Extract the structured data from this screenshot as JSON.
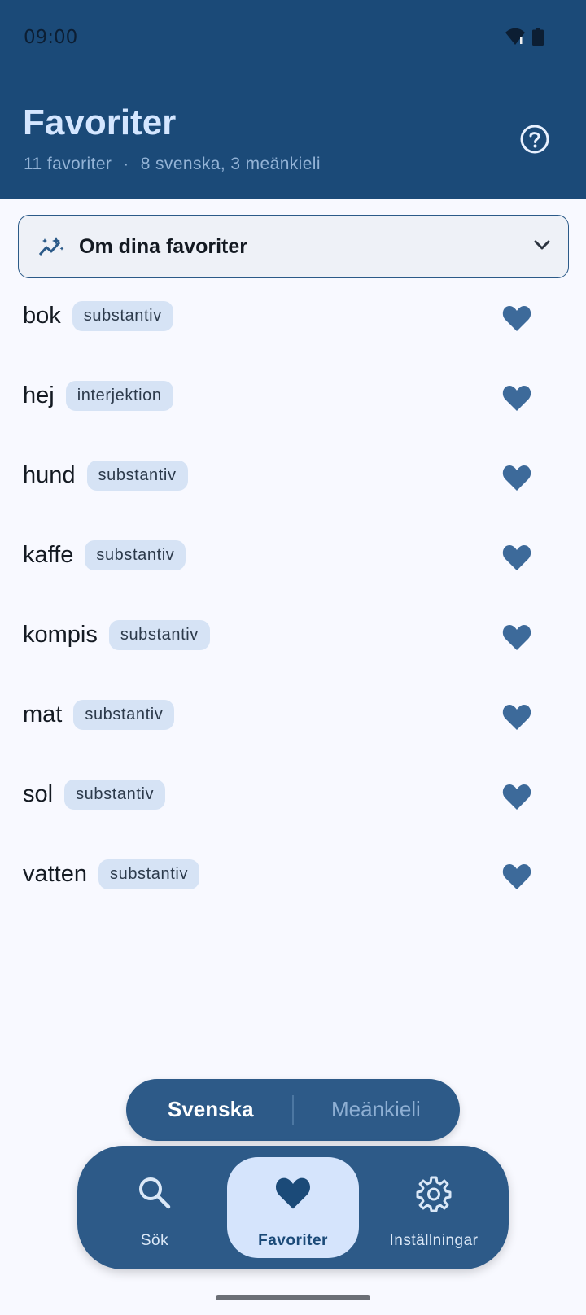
{
  "status_bar": {
    "time": "09:00"
  },
  "header": {
    "title": "Favoriter",
    "count": "11 favoriter",
    "separator": "·",
    "breakdown": "8 svenska, 3 meänkieli"
  },
  "about_card": {
    "label": "Om dina favoriter"
  },
  "favorites": [
    {
      "word": "bok",
      "pos": "substantiv"
    },
    {
      "word": "hej",
      "pos": "interjektion"
    },
    {
      "word": "hund",
      "pos": "substantiv"
    },
    {
      "word": "kaffe",
      "pos": "substantiv"
    },
    {
      "word": "kompis",
      "pos": "substantiv"
    },
    {
      "word": "mat",
      "pos": "substantiv"
    },
    {
      "word": "sol",
      "pos": "substantiv"
    },
    {
      "word": "vatten",
      "pos": "substantiv"
    }
  ],
  "language_toggle": {
    "selected": "Svenska",
    "options": [
      "Svenska",
      "Meänkieli"
    ]
  },
  "bottom_nav": {
    "items": [
      {
        "label": "Sök",
        "icon": "search-icon"
      },
      {
        "label": "Favoriter",
        "icon": "heart-icon"
      },
      {
        "label": "Inställningar",
        "icon": "gear-icon"
      }
    ],
    "active": "Favoriter"
  },
  "colors": {
    "header_bg": "#1b4a78",
    "accent": "#2d5a88",
    "heart": "#3d6a9a",
    "chip_bg": "#d6e3f5",
    "page_bg": "#f8f9ff"
  }
}
